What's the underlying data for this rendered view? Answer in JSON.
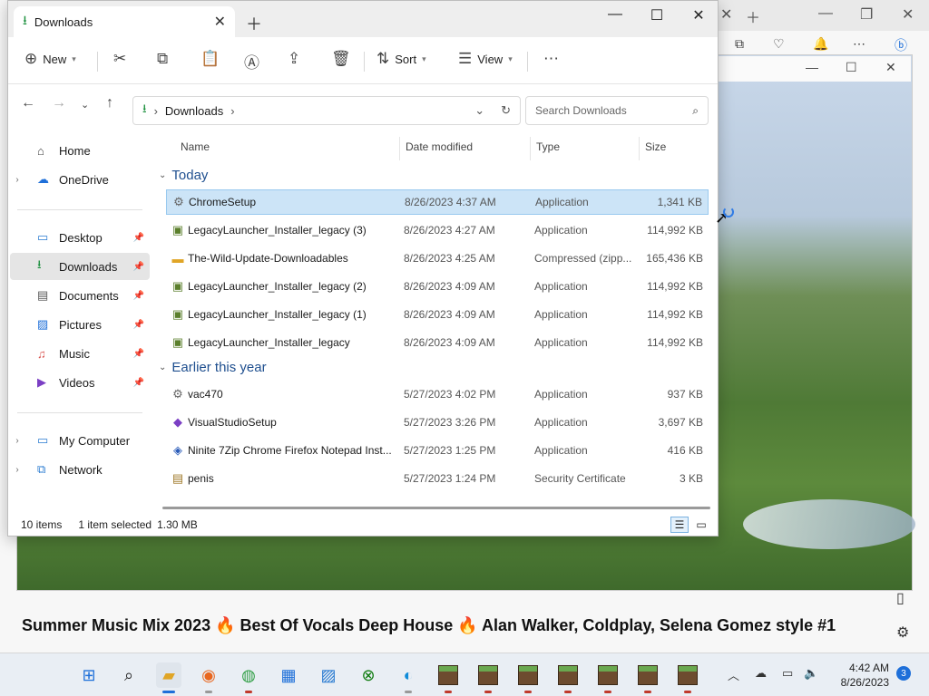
{
  "browser": {
    "video_title": "Summer Music Mix 2023 🔥 Best Of Vocals Deep House 🔥 Alan Walker, Coldplay, Selena Gomez style #1"
  },
  "explorer": {
    "tab_title": "Downloads",
    "toolbar": {
      "new_label": "New",
      "sort_label": "Sort",
      "view_label": "View"
    },
    "address": {
      "location": "Downloads",
      "search_placeholder": "Search Downloads"
    },
    "nav": [
      {
        "label": "Home",
        "icon": "home-icon",
        "expandable": false,
        "pinned": false
      },
      {
        "label": "OneDrive",
        "icon": "cloud-icon",
        "expandable": true,
        "pinned": false
      },
      {
        "label": "Desktop",
        "icon": "desktop-icon",
        "expandable": false,
        "pinned": true
      },
      {
        "label": "Downloads",
        "icon": "download-icon",
        "expandable": false,
        "pinned": true,
        "selected": true
      },
      {
        "label": "Documents",
        "icon": "document-icon",
        "expandable": false,
        "pinned": true
      },
      {
        "label": "Pictures",
        "icon": "picture-icon",
        "expandable": false,
        "pinned": true
      },
      {
        "label": "Music",
        "icon": "music-icon",
        "expandable": false,
        "pinned": true
      },
      {
        "label": "Videos",
        "icon": "video-icon",
        "expandable": false,
        "pinned": true
      },
      {
        "label": "My Computer",
        "icon": "computer-icon",
        "expandable": true,
        "pinned": false
      },
      {
        "label": "Network",
        "icon": "network-icon",
        "expandable": true,
        "pinned": false
      }
    ],
    "columns": {
      "name": "Name",
      "date": "Date modified",
      "type": "Type",
      "size": "Size"
    },
    "groups": [
      {
        "label": "Today",
        "files": [
          {
            "name": "ChromeSetup",
            "date": "8/26/2023 4:37 AM",
            "type": "Application",
            "size": "1,341 KB",
            "icon": "installer-icon",
            "selected": true
          },
          {
            "name": "LegacyLauncher_Installer_legacy (3)",
            "date": "8/26/2023 4:27 AM",
            "type": "Application",
            "size": "114,992 KB",
            "icon": "minecraft-icon"
          },
          {
            "name": "The-Wild-Update-Downloadables",
            "date": "8/26/2023 4:25 AM",
            "type": "Compressed (zipp...",
            "size": "165,436 KB",
            "icon": "zip-folder-icon"
          },
          {
            "name": "LegacyLauncher_Installer_legacy (2)",
            "date": "8/26/2023 4:09 AM",
            "type": "Application",
            "size": "114,992 KB",
            "icon": "minecraft-icon"
          },
          {
            "name": "LegacyLauncher_Installer_legacy (1)",
            "date": "8/26/2023 4:09 AM",
            "type": "Application",
            "size": "114,992 KB",
            "icon": "minecraft-icon"
          },
          {
            "name": "LegacyLauncher_Installer_legacy",
            "date": "8/26/2023 4:09 AM",
            "type": "Application",
            "size": "114,992 KB",
            "icon": "minecraft-icon"
          }
        ]
      },
      {
        "label": "Earlier this year",
        "files": [
          {
            "name": "vac470",
            "date": "5/27/2023 4:02 PM",
            "type": "Application",
            "size": "937 KB",
            "icon": "installer-icon"
          },
          {
            "name": "VisualStudioSetup",
            "date": "5/27/2023 3:26 PM",
            "type": "Application",
            "size": "3,697 KB",
            "icon": "visual-studio-icon"
          },
          {
            "name": "Ninite 7Zip Chrome Firefox Notepad Inst...",
            "date": "5/27/2023 1:25 PM",
            "type": "Application",
            "size": "416 KB",
            "icon": "ninite-icon"
          },
          {
            "name": "penis",
            "date": "5/27/2023 1:24 PM",
            "type": "Security Certificate",
            "size": "3 KB",
            "icon": "certificate-icon"
          }
        ]
      }
    ],
    "status": {
      "count": "10 items",
      "selected": "1 item selected",
      "size": "1.30 MB"
    }
  },
  "taskbar": {
    "time": "4:42 AM",
    "date": "8/26/2023",
    "notifications": "3"
  }
}
